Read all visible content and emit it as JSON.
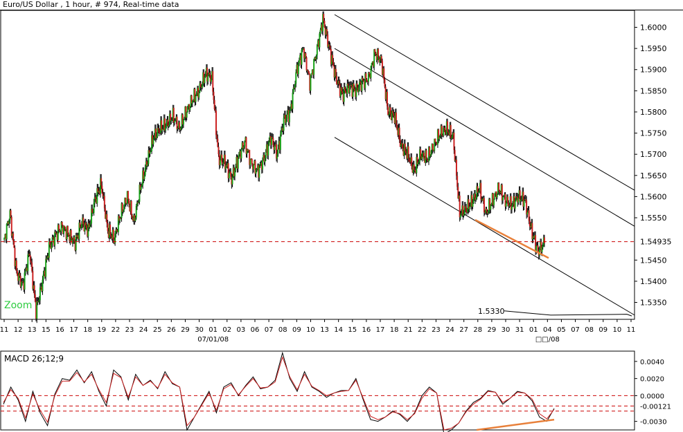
{
  "header": {
    "title": "Euro/US Dollar , 1 hour, # 974, Real-time data"
  },
  "macd_panel": {
    "title": "MACD 26;12;9"
  },
  "chart_data": [
    {
      "type": "line",
      "style": "candlestick-like price series (hourly)",
      "title": "Euro/US Dollar , 1 hour, # 974, Real-time data",
      "xlabel": "",
      "ylabel": "",
      "ylim": [
        1.531,
        1.604
      ],
      "y_ticks": [
        1.6,
        1.595,
        1.59,
        1.585,
        1.58,
        1.575,
        1.57,
        1.565,
        1.56,
        1.555,
        1.545,
        1.54,
        1.535
      ],
      "y_tick_labels": [
        "1.6000",
        "1.5950",
        "1.5900",
        "1.5850",
        "1.5800",
        "1.5750",
        "1.5700",
        "1.5650",
        "1.5600",
        "1.5550",
        "1.5450",
        "1.5400",
        "1.5350"
      ],
      "current_price_label": "1.54935",
      "current_price": 1.54935,
      "x_tick_labels": [
        "11",
        "12",
        "13",
        "15",
        "16",
        "17",
        "18",
        "19",
        "22",
        "23",
        "24",
        "25",
        "26",
        "29",
        "30",
        "01",
        "02",
        "03",
        "06",
        "07",
        "08",
        "09",
        "10",
        "13",
        "14",
        "15",
        "16",
        "17",
        "18",
        "21",
        "22",
        "23",
        "24",
        "27",
        "28",
        "29",
        "30",
        "31",
        "01",
        "04",
        "05",
        "07",
        "08",
        "09",
        "10",
        "11"
      ],
      "date_labels": [
        {
          "label": "07/01/08",
          "after_tick": "01"
        },
        {
          "label": "□□/08",
          "after_tick": "04"
        }
      ],
      "price_path": [
        1.549,
        1.556,
        1.542,
        1.539,
        1.547,
        1.533,
        1.54,
        1.548,
        1.551,
        1.553,
        1.551,
        1.549,
        1.554,
        1.552,
        1.559,
        1.563,
        1.552,
        1.55,
        1.556,
        1.56,
        1.554,
        1.562,
        1.568,
        1.574,
        1.576,
        1.577,
        1.579,
        1.576,
        1.58,
        1.583,
        1.585,
        1.589,
        1.588,
        1.569,
        1.568,
        1.564,
        1.569,
        1.573,
        1.568,
        1.566,
        1.569,
        1.574,
        1.57,
        1.578,
        1.58,
        1.59,
        1.595,
        1.587,
        1.594,
        1.602,
        1.595,
        1.588,
        1.584,
        1.586,
        1.585,
        1.587,
        1.588,
        1.594,
        1.592,
        1.58,
        1.579,
        1.572,
        1.57,
        1.566,
        1.57,
        1.569,
        1.572,
        1.575,
        1.576,
        1.574,
        1.556,
        1.557,
        1.559,
        1.562,
        1.556,
        1.559,
        1.562,
        1.559,
        1.558,
        1.56,
        1.559,
        1.552,
        1.547,
        1.549
      ],
      "price_path_label": "",
      "channel_lines": [
        {
          "role": "upper",
          "from": 1.603,
          "to": 1.5615
        },
        {
          "role": "middle",
          "from": 1.595,
          "to": 1.553
        },
        {
          "role": "lower",
          "from": 1.574,
          "to": 1.532
        }
      ],
      "divergence_line": {
        "from": 1.5545,
        "to": 1.5455,
        "color": "#e8803a"
      },
      "annotations": [
        {
          "text": "Zoom",
          "color": "#2ecc40"
        },
        {
          "text": "1.5330",
          "value": 1.533
        }
      ],
      "colors": {
        "up": "#1aa31a",
        "down": "#cc2222",
        "wick": "#000000",
        "current_line": "#cc0000"
      }
    },
    {
      "type": "line",
      "title": "MACD 26;12;9",
      "ylim": [
        -0.004,
        0.0052
      ],
      "y_ticks": [
        0.004,
        0.002,
        0.0,
        -0.003
      ],
      "y_tick_labels": [
        "0.0040",
        "0.0020",
        "0.0000",
        "-0.0030"
      ],
      "current_value_label": "-0.00121",
      "current_value": -0.00121,
      "reference_lines": [
        0.0,
        -0.00121,
        -0.0018
      ],
      "series": [
        {
          "name": "",
          "color": "#000000",
          "values": [
            -0.001,
            0.001,
            -0.0005,
            -0.003,
            0.0005,
            -0.002,
            -0.0035,
            0.0002,
            0.002,
            0.0018,
            0.003,
            0.0015,
            0.0028,
            0.0005,
            -0.0012,
            0.003,
            0.0022,
            -0.0005,
            0.0025,
            0.0012,
            0.0018,
            0.0008,
            0.0028,
            0.0014,
            0.001,
            -0.004,
            -0.0025,
            -0.001,
            0.0005,
            -0.002,
            0.001,
            0.0015,
            0.0,
            0.0012,
            0.0022,
            0.0008,
            0.001,
            0.0018,
            0.005,
            0.002,
            0.0005,
            0.0028,
            0.001,
            0.0005,
            -0.0002,
            0.0003,
            0.0006,
            0.0006,
            0.002,
            -0.0005,
            -0.0028,
            -0.003,
            -0.0025,
            -0.0018,
            -0.0022,
            -0.003,
            -0.002,
            0.0,
            0.001,
            0.0003,
            -0.0045,
            -0.004,
            -0.0032,
            -0.0018,
            -0.0008,
            -0.0003,
            0.0006,
            0.0004,
            -0.001,
            -0.0003,
            0.0005,
            0.0003,
            -0.0006,
            -0.0025,
            -0.003,
            -0.0015
          ]
        },
        {
          "name": "",
          "color": "#cc2222",
          "values": [
            -0.0008,
            0.0007,
            -0.0003,
            -0.0026,
            0.0002,
            -0.0017,
            -0.0031,
            0.0,
            0.0017,
            0.0017,
            0.0027,
            0.0016,
            0.0025,
            0.0007,
            -0.0008,
            0.0026,
            0.0021,
            -0.0002,
            0.0022,
            0.0012,
            0.0017,
            0.0009,
            0.0025,
            0.0015,
            0.001,
            -0.0035,
            -0.0025,
            -0.0011,
            0.0003,
            -0.0017,
            0.0008,
            0.0013,
            0.0001,
            0.0011,
            0.002,
            0.0009,
            0.001,
            0.0016,
            0.0045,
            0.0022,
            0.0007,
            0.0025,
            0.0011,
            0.0006,
            0.0,
            0.0003,
            0.0005,
            0.0006,
            0.0018,
            -0.0003,
            -0.0024,
            -0.0028,
            -0.0025,
            -0.0019,
            -0.0021,
            -0.0028,
            -0.0021,
            -0.0003,
            0.0008,
            0.0003,
            -0.004,
            -0.0038,
            -0.0032,
            -0.0019,
            -0.001,
            -0.0004,
            0.0005,
            0.0004,
            -0.0008,
            -0.0003,
            0.0004,
            0.0003,
            -0.0004,
            -0.0021,
            -0.0027,
            -0.0016
          ]
        }
      ],
      "divergence_line": {
        "from": -0.004,
        "to": -0.0028,
        "color": "#e8803a"
      }
    }
  ]
}
